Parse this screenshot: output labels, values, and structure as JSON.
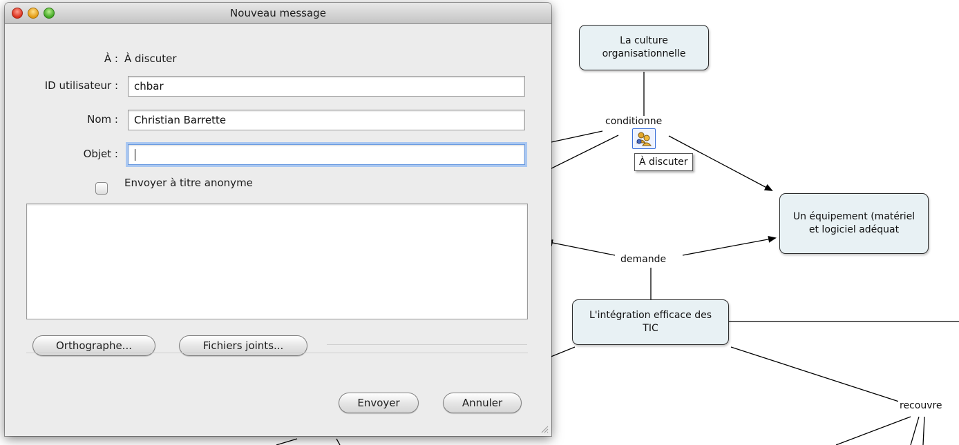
{
  "dialog": {
    "title": "Nouveau message",
    "to_label": "À :",
    "to_value": "À discuter",
    "user_id_label": "ID utilisateur :",
    "user_id_value": "chbar",
    "name_label": "Nom :",
    "name_value": "Christian Barrette",
    "subject_label": "Objet :",
    "subject_value": "",
    "anonymous_label": "Envoyer à titre anonyme",
    "anonymous_checked": false,
    "message_body": "",
    "spelling_button": "Orthographe...",
    "attachments_button": "Fichiers joints...",
    "send_button": "Envoyer",
    "cancel_button": "Annuler"
  },
  "concept_map": {
    "concepts": {
      "culture": "La culture organisationnelle",
      "equipment": "Un équipement (matériel et logiciel adéquat",
      "integration": "L'intégration efficace des TIC"
    },
    "links": {
      "conditionne": "conditionne",
      "demande": "demande",
      "recouvre": "recouvre"
    },
    "discussion_icon": "discussion-people-icon",
    "tooltip": "À discuter"
  },
  "colors": {
    "concept_fill": "#e8f1f4",
    "focus_ring": "#a9c7f1"
  }
}
